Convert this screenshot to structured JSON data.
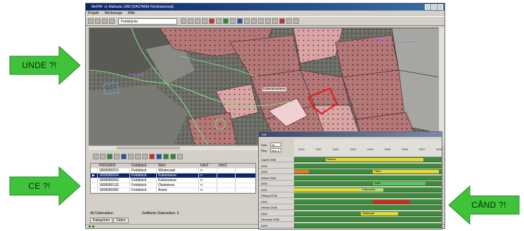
{
  "arrows": {
    "unde": "UNDE ?!",
    "ce": "CE ?!",
    "cand": "CÂND ?!"
  },
  "colors": {
    "arrow_green": "#3ec33a",
    "selection": "#0a246a",
    "parcel_pink": "#c98a8a",
    "highlight_red": "#e81c1c",
    "gantt_green": "#3f8a3f",
    "bar_yellow": "#e6d832",
    "bar_red": "#d42a1a",
    "bar_orange": "#e27a18"
  },
  "app": {
    "title": "MePAF v1 Maltauta 1960 [DACHWEI-Nordosterzeal]",
    "menu": [
      "Projekt",
      "Werkzeuge",
      "Hilfe"
    ],
    "layer_select": "Feldstücke",
    "map_labels": {
      "label_1": "Feldstück",
      "label_2": "Extensivwiese",
      "label_3": "Kultur"
    }
  },
  "grid": {
    "columns": [
      "PROGRID",
      "Feldstück",
      "Wert",
      "Info2",
      "Info3"
    ],
    "rows": [
      {
        "id": "1808080023",
        "a": "Feldstück",
        "b": "Wintersaat",
        "c": "n"
      },
      {
        "id": "1808080024",
        "a": "Feldstück",
        "b": "Kulturwiese",
        "c": "n"
      },
      {
        "id": "1808080093",
        "a": "Feldstück",
        "b": "Kulturwiese",
        "c": "n"
      },
      {
        "id": "1808080132",
        "a": "Feldstück",
        "b": "Obstwiese",
        "c": "n"
      },
      {
        "id": "1808080082",
        "a": "Feldstück",
        "b": "Acker",
        "c": "n"
      }
    ],
    "status_left": "Alt Datensätze:",
    "status_right": "Gefilterte Datensätze: 0",
    "tabs": [
      "Kategorien",
      "Daten"
    ]
  },
  "gantt": {
    "title": "Zeit",
    "controls": {
      "start_label": "Start",
      "start_value": "08",
      "step_label": "Step",
      "step_value": "Mon 0"
    },
    "ticks": [
      "2000",
      "2001",
      "2002",
      "2003",
      "2004",
      "2005",
      "2006",
      "2007",
      "2008"
    ],
    "rows": [
      {
        "label": "Capell  2008",
        "bars": [
          {
            "c": "#e6d832",
            "s": 0.21,
            "e": 0.87,
            "t": "Bestand"
          }
        ]
      },
      {
        "label": "   2003",
        "bars": []
      },
      {
        "label": "   2002",
        "bars": [
          {
            "c": "#e27a18",
            "s": 0.0,
            "e": 0.1,
            "t": ""
          },
          {
            "c": "#e6d832",
            "s": 0.53,
            "e": 0.97,
            "t": "Pflanz"
          }
        ]
      },
      {
        "label": "Wiese  2008",
        "bars": []
      },
      {
        "label": "   2003",
        "bars": [
          {
            "c": "#5cc45c",
            "s": 0.53,
            "e": 0.88,
            "t": "Acker"
          }
        ]
      },
      {
        "label": "   2002",
        "bars": [
          {
            "c": "#e6d832",
            "s": 0.0,
            "e": 0.47,
            "t": ""
          },
          {
            "c": "#b8e070",
            "s": 0.45,
            "e": 0.6,
            "t": "Kulturwiese"
          }
        ]
      },
      {
        "label": "Strkarg  2008",
        "bars": []
      },
      {
        "label": "   2003",
        "bars": [
          {
            "c": "#d42a1a",
            "s": 0.53,
            "e": 0.78,
            "t": ""
          }
        ]
      },
      {
        "label": "Viehsw  2008",
        "bars": []
      },
      {
        "label": "   2002",
        "bars": [
          {
            "c": "#e6d832",
            "s": 0.45,
            "e": 0.7,
            "t": "Wintersaat"
          }
        ]
      },
      {
        "label": "Uberland  2008",
        "bars": []
      },
      {
        "label": "   2002",
        "bars": []
      }
    ]
  }
}
